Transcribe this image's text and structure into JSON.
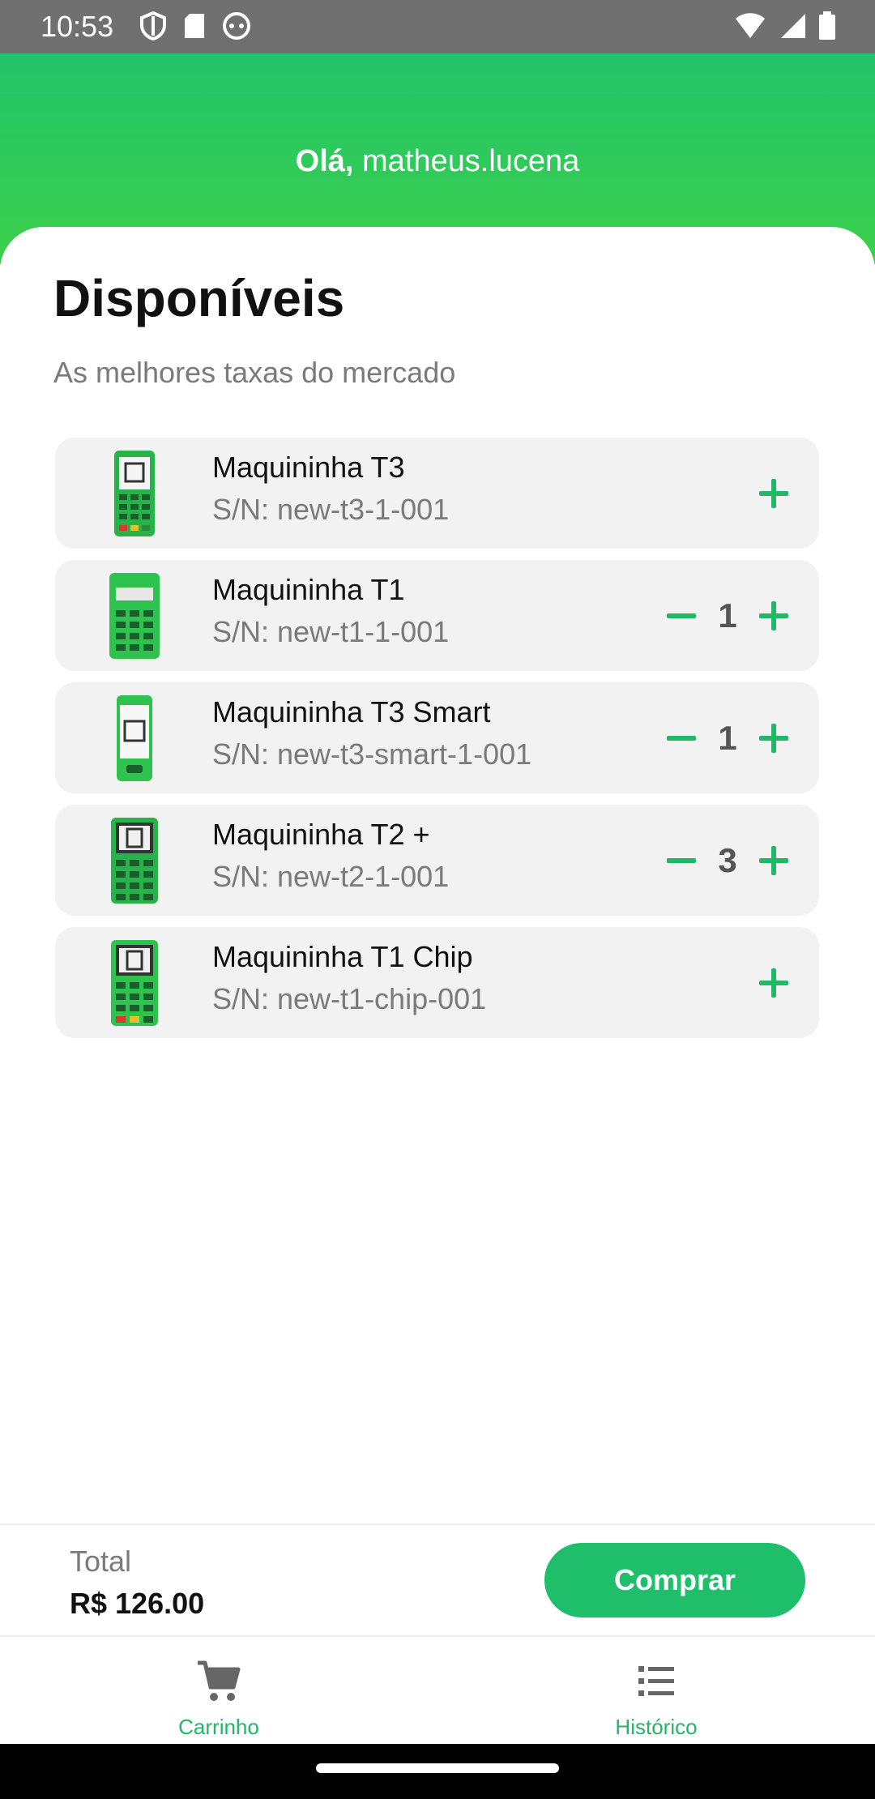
{
  "status_bar": {
    "time": "10:53"
  },
  "header": {
    "greeting_bold": "Olá,",
    "username": "matheus.lucena"
  },
  "main": {
    "title": "Disponíveis",
    "subtitle": "As melhores taxas do mercado",
    "products": [
      {
        "name": "Maquininha T3",
        "serial": "S/N: new-t3-1-001",
        "quantity": null
      },
      {
        "name": "Maquininha T1",
        "serial": "S/N: new-t1-1-001",
        "quantity": "1"
      },
      {
        "name": "Maquininha T3 Smart",
        "serial": "S/N: new-t3-smart-1-001",
        "quantity": "1"
      },
      {
        "name": "Maquininha T2 +",
        "serial": "S/N: new-t2-1-001",
        "quantity": "3"
      },
      {
        "name": "Maquininha T1 Chip",
        "serial": "S/N: new-t1-chip-001",
        "quantity": null
      }
    ]
  },
  "footer": {
    "total_label": "Total",
    "total_value": "R$ 126.00",
    "buy_label": "Comprar"
  },
  "nav": [
    {
      "label": "Carrinho",
      "icon": "cart-icon"
    },
    {
      "label": "Histórico",
      "icon": "list-icon"
    }
  ],
  "colors": {
    "accent": "#1fbe6b",
    "header_top": "#22c46c",
    "header_bottom": "#3ccf4a",
    "status_bar": "#707070"
  }
}
